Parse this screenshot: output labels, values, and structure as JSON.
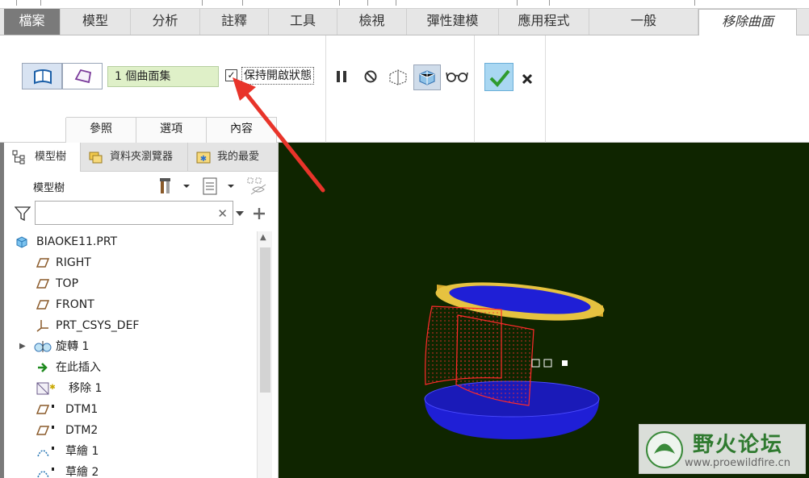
{
  "tabs": [
    {
      "label": "檔案",
      "kind": "file"
    },
    {
      "label": "模型",
      "kind": "normal"
    },
    {
      "label": "分析",
      "kind": "normal"
    },
    {
      "label": "註釋",
      "kind": "normal"
    },
    {
      "label": "工具",
      "kind": "normal"
    },
    {
      "label": "檢視",
      "kind": "normal"
    },
    {
      "label": "彈性建模",
      "kind": "normal"
    },
    {
      "label": "應用程式",
      "kind": "normal"
    },
    {
      "label": "一般",
      "kind": "normal"
    },
    {
      "label": "移除曲面",
      "kind": "active"
    }
  ],
  "ribbon": {
    "collector_value": "1 個曲面集",
    "keep_open_label": "保持開啟狀態",
    "keep_open_checked": true,
    "subtabs": [
      "參照",
      "選項",
      "內容"
    ]
  },
  "panel": {
    "tabs": [
      "模型樹",
      "資料夾瀏覽器",
      "我的最愛"
    ],
    "tree_title": "模型樹",
    "filter_placeholder": "",
    "items": [
      {
        "label": "BIAOKE11.PRT",
        "icon": "part-icon",
        "indent": 0
      },
      {
        "label": "RIGHT",
        "icon": "datum-plane-icon",
        "indent": 1
      },
      {
        "label": "TOP",
        "icon": "datum-plane-icon",
        "indent": 1
      },
      {
        "label": "FRONT",
        "icon": "datum-plane-icon",
        "indent": 1
      },
      {
        "label": "PRT_CSYS_DEF",
        "icon": "csys-icon",
        "indent": 1
      },
      {
        "label": "旋轉 1",
        "icon": "revolve-icon",
        "indent": 1,
        "expandable": true
      },
      {
        "label": "在此插入",
        "icon": "insert-arrow-icon",
        "indent": 1
      },
      {
        "label": "移除 1",
        "icon": "remove-feature-icon",
        "indent": 1
      },
      {
        "label": "DTM1",
        "icon": "datum-plane-icon",
        "indent": 1
      },
      {
        "label": "DTM2",
        "icon": "datum-plane-icon",
        "indent": 1
      },
      {
        "label": "草繪 1",
        "icon": "sketch-icon",
        "indent": 1
      },
      {
        "label": "草繪 2",
        "icon": "sketch-icon",
        "indent": 1
      }
    ]
  },
  "watermark": {
    "title": "野火论坛",
    "url": "www.proewildfire.cn"
  },
  "colors": {
    "viewport_bg": "#0f2500",
    "collector_bg": "#dff0c8",
    "ok_green": "#2e9b2e",
    "arrow_red": "#e8342a",
    "lid_gold": "#e6c240",
    "body_blue": "#1f1fd6"
  }
}
